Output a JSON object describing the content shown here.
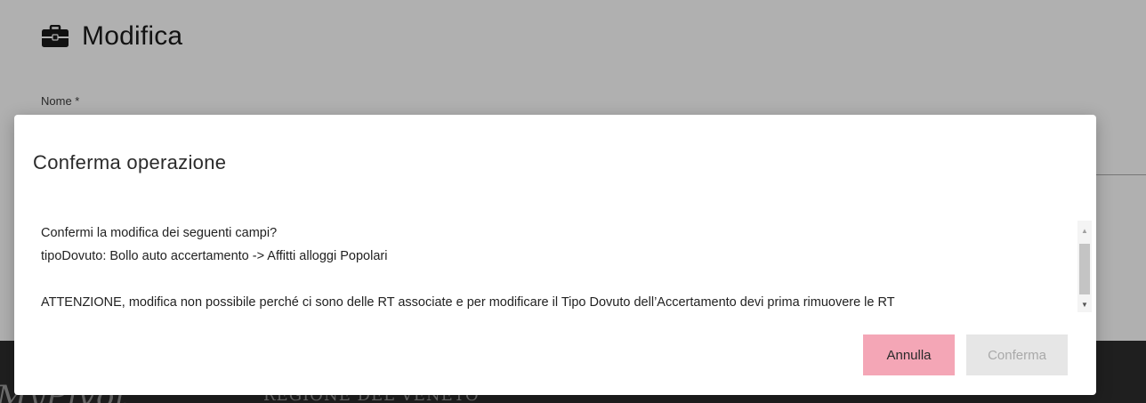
{
  "page": {
    "title": "Modifica",
    "title_icon": "briefcase-icon",
    "field_label": "Nome *"
  },
  "footer": {
    "logo_text": "MyPivot",
    "region_text": "REGIONE DEL VENETO"
  },
  "modal": {
    "title": "Conferma operazione",
    "body_lines": [
      "Confermi la modifica dei seguenti campi?",
      "tipoDovuto: Bollo auto accertamento -> Affitti alloggi Popolari",
      "ATTENZIONE, modifica non possibile perché ci sono delle RT associate e per modificare il Tipo Dovuto dell’Accertamento devi prima rimuovere le RT"
    ],
    "buttons": {
      "cancel_label": "Annulla",
      "confirm_label": "Conferma",
      "confirm_disabled": true
    }
  },
  "colors": {
    "overlay_background": "#b0b0b0",
    "cancel_button": "#f4a6b6",
    "confirm_button_disabled": "#e6e6e6",
    "footer_band": "#1f1f1f"
  }
}
